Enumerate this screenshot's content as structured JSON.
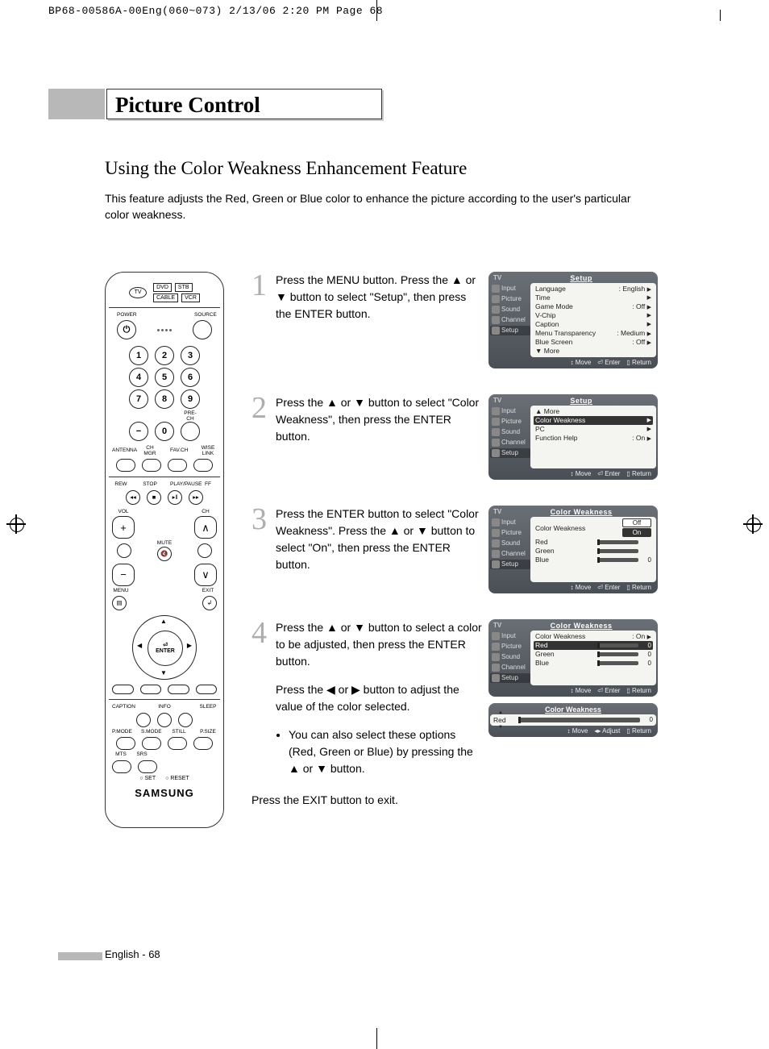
{
  "print_header": "BP68-00586A-00Eng(060~073)  2/13/06  2:20 PM  Page 68",
  "page_title": "Picture Control",
  "section_title": "Using the Color Weakness Enhancement Feature",
  "intro": "This feature adjusts the Red, Green or Blue color to enhance the picture according to the user's particular color weakness.",
  "footer": "English - 68",
  "remote": {
    "top_boxes": [
      "DVD",
      "STB",
      "CABLE",
      "VCR"
    ],
    "tv": "TV",
    "power": "POWER",
    "source": "SOURCE",
    "numbers": [
      "1",
      "2",
      "3",
      "4",
      "5",
      "6",
      "7",
      "8",
      "9",
      "0"
    ],
    "dash": "−",
    "prech": "PRE-CH",
    "row_labels": [
      "ANTENNA",
      "CH MGR",
      "FAV.CH",
      "WISE LINK"
    ],
    "transport": [
      "REW",
      "STOP",
      "PLAY/PAUSE",
      "FF"
    ],
    "vol": "VOL",
    "ch": "CH",
    "mute": "MUTE",
    "menu": "MENU",
    "exit": "EXIT",
    "enter": "ENTER",
    "bot1": [
      "CAPTION",
      "INFO",
      "SLEEP"
    ],
    "bot2": [
      "P.MODE",
      "S.MODE",
      "STILL",
      "P.SIZE"
    ],
    "bot3": [
      "MTS",
      "SRS"
    ],
    "bot4": [
      "SET",
      "RESET"
    ],
    "logo": "SAMSUNG"
  },
  "steps": [
    {
      "num": "1",
      "text": "Press the MENU button. Press the ▲ or ▼ button to select \"Setup\", then press the ENTER button.",
      "osd": {
        "tv": "TV",
        "title": "Setup",
        "side": [
          "Input",
          "Picture",
          "Sound",
          "Channel",
          "Setup"
        ],
        "rows": [
          {
            "l": "Language",
            "r": ": English",
            "a": "▶"
          },
          {
            "l": "Time",
            "r": "",
            "a": "▶"
          },
          {
            "l": "Game Mode",
            "r": ": Off",
            "a": "▶"
          },
          {
            "l": "V-Chip",
            "r": "",
            "a": "▶"
          },
          {
            "l": "Caption",
            "r": "",
            "a": "▶"
          },
          {
            "l": "Menu Transparency",
            "r": ": Medium",
            "a": "▶"
          },
          {
            "l": "Blue Screen",
            "r": ": Off",
            "a": "▶"
          },
          {
            "l": "▼ More",
            "r": "",
            "a": ""
          }
        ],
        "foot": [
          "Move",
          "Enter",
          "Return"
        ]
      }
    },
    {
      "num": "2",
      "text": "Press the ▲ or ▼ button to select \"Color Weakness\", then press the ENTER button.",
      "osd": {
        "tv": "TV",
        "title": "Setup",
        "side": [
          "Input",
          "Picture",
          "Sound",
          "Channel",
          "Setup"
        ],
        "rows": [
          {
            "l": "▲ More",
            "r": "",
            "a": ""
          },
          {
            "l": "Color Weakness",
            "r": "",
            "a": "▶",
            "hl": true
          },
          {
            "l": "PC",
            "r": "",
            "a": "▶"
          },
          {
            "l": "Function Help",
            "r": ": On",
            "a": "▶"
          }
        ],
        "foot": [
          "Move",
          "Enter",
          "Return"
        ]
      }
    },
    {
      "num": "3",
      "text": "Press the ENTER button to select \"Color Weakness\". Press the ▲ or ▼ button to select \"On\", then press the ENTER button.",
      "osd": {
        "tv": "TV",
        "title": "Color Weakness",
        "side": [
          "Input",
          "Picture",
          "Sound",
          "Channel",
          "Setup"
        ],
        "cw": true,
        "cw_opt_off": "Off",
        "cw_opt_on": "On",
        "rows": [
          {
            "l": "Color Weakness",
            "type": "opts"
          },
          {
            "l": "Red",
            "type": "slider",
            "v": ""
          },
          {
            "l": "Green",
            "type": "slider",
            "v": ""
          },
          {
            "l": "Blue",
            "type": "slider",
            "v": "0"
          }
        ],
        "foot": [
          "Move",
          "Enter",
          "Return"
        ]
      }
    },
    {
      "num": "4",
      "text": "Press the ▲ or ▼ button to select a color to be adjusted, then press the ENTER button.",
      "sub": "Press the ◀ or ▶ button to adjust the value of the color selected.",
      "bullet": "You can also select these options (Red, Green or Blue) by pressing the ▲ or ▼ button.",
      "exit": "Press the EXIT button to exit.",
      "osd": {
        "tv": "TV",
        "title": "Color Weakness",
        "side": [
          "Input",
          "Picture",
          "Sound",
          "Channel",
          "Setup"
        ],
        "rows": [
          {
            "l": "Color Weakness",
            "r": ": On",
            "a": "▶"
          },
          {
            "l": "Red",
            "type": "slider",
            "v": "0",
            "hl": true
          },
          {
            "l": "Green",
            "type": "slider",
            "v": "0"
          },
          {
            "l": "Blue",
            "type": "slider",
            "v": "0"
          }
        ],
        "foot": [
          "Move",
          "Enter",
          "Return"
        ]
      },
      "osd2": {
        "title": "Color Weakness",
        "label": "Red",
        "value": "0",
        "foot": [
          "Move",
          "Adjust",
          "Return"
        ]
      }
    }
  ]
}
